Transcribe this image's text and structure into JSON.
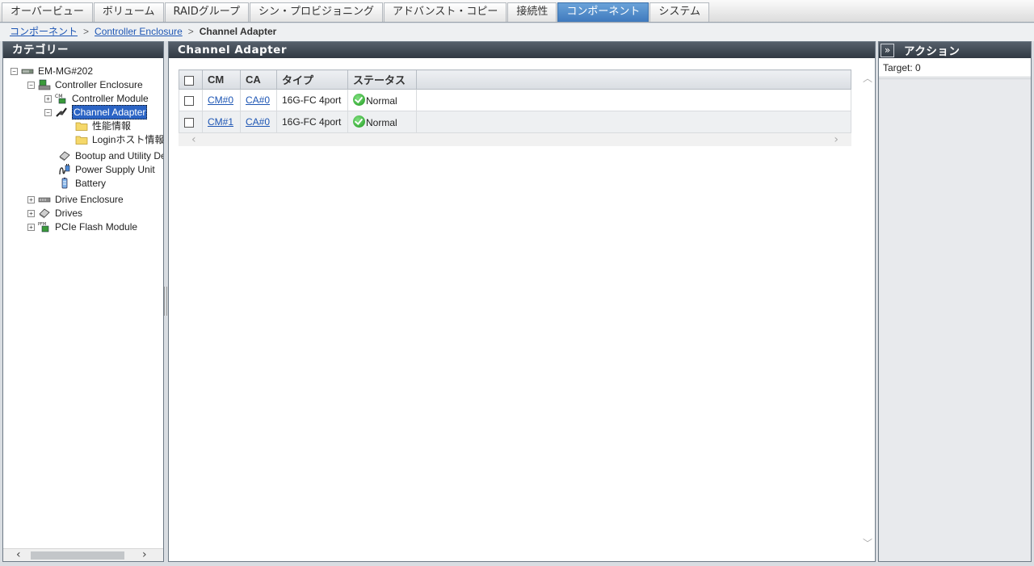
{
  "tabs": [
    {
      "label": "オーバービュー",
      "active": false
    },
    {
      "label": "ボリューム",
      "active": false
    },
    {
      "label": "RAIDグループ",
      "active": false
    },
    {
      "label": "シン・プロビジョニング",
      "active": false
    },
    {
      "label": "アドバンスト・コピー",
      "active": false
    },
    {
      "label": "接続性",
      "active": false
    },
    {
      "label": "コンポーネント",
      "active": true
    },
    {
      "label": "システム",
      "active": false
    }
  ],
  "breadcrumb": {
    "items": [
      "コンポーネント",
      "Controller Enclosure"
    ],
    "current": "Channel Adapter",
    "separator": ">"
  },
  "category_panel": {
    "title": "カテゴリー",
    "tree": {
      "root": "EM-MG#202",
      "controller_enclosure": "Controller Enclosure",
      "controller_module": "Controller Module",
      "channel_adapter": "Channel Adapter",
      "perf_info": "性能情報",
      "login_host_info": "Loginホスト情報",
      "bootup_utility": "Bootup and Utility De",
      "power_supply": "Power Supply Unit",
      "battery": "Battery",
      "drive_enclosure": "Drive Enclosure",
      "drives": "Drives",
      "pcie_flash": "PCIe Flash Module"
    }
  },
  "main_panel": {
    "title": "Channel Adapter",
    "columns": [
      "CM",
      "CA",
      "タイプ",
      "ステータス"
    ],
    "rows": [
      {
        "cm": "CM#0",
        "ca": "CA#0",
        "type": "16G-FC 4port",
        "status": "Normal"
      },
      {
        "cm": "CM#1",
        "ca": "CA#0",
        "type": "16G-FC 4port",
        "status": "Normal"
      }
    ]
  },
  "action_panel": {
    "title": "アクション",
    "collapse_label": "»",
    "target_label": "Target:",
    "target_value": "0"
  },
  "colors": {
    "tab_active": "#3f79bd",
    "panel_header": "#3a434d",
    "link": "#1e56b4",
    "status_ok": "#1f9a1f",
    "selection": "#2b64c5"
  }
}
